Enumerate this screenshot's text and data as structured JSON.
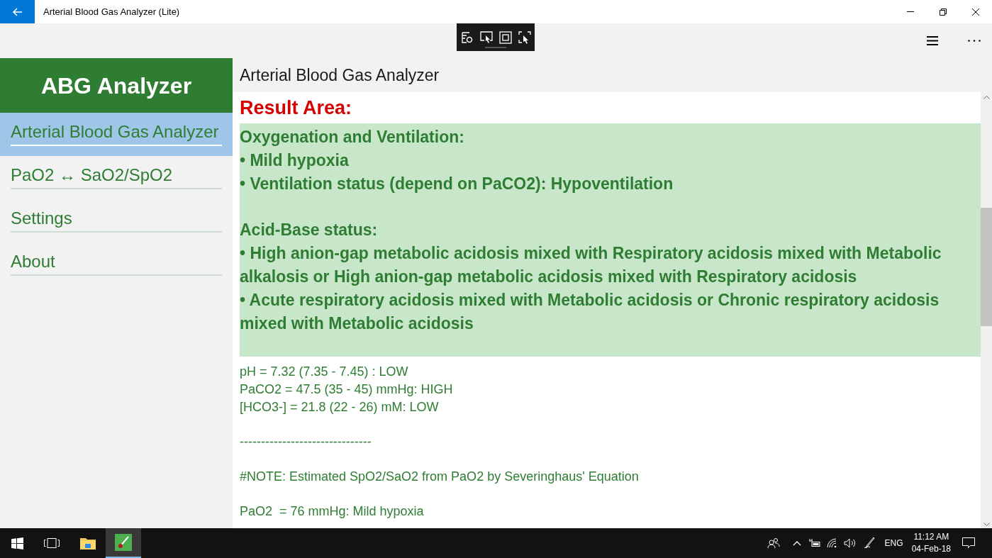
{
  "window": {
    "title": "Arterial Blood Gas Analyzer (Lite)"
  },
  "sidebar": {
    "app_title": "ABG Analyzer",
    "items": [
      {
        "label": "Arterial Blood Gas Analyzer",
        "selected": true
      },
      {
        "label": "PaO2 ↔ SaO2/SpO2",
        "selected": false
      },
      {
        "label": "Settings",
        "selected": false
      },
      {
        "label": "About",
        "selected": false
      }
    ]
  },
  "main": {
    "page_title": "Arterial Blood Gas Analyzer",
    "result_heading": "Result Area:",
    "result_box": [
      {
        "heading": "Oxygenation and Ventilation:",
        "bullets": [
          "• Mild hypoxia",
          "• Ventilation status (depend on PaCO2): Hypoventilation"
        ]
      },
      {
        "heading": "Acid-Base status:",
        "bullets": [
          "• High anion-gap metabolic acidosis mixed with Respiratory acidosis mixed with Metabolic alkalosis or High anion-gap metabolic acidosis mixed with Respiratory acidosis",
          "• Acute respiratory acidosis mixed with Metabolic acidosis or Chronic respiratory acidosis mixed with Metabolic acidosis"
        ]
      }
    ],
    "details": [
      [
        "pH = 7.32 (7.35 - 7.45) : LOW",
        "PaCO2 = 47.5 (35 - 45) mmHg: HIGH",
        "[HCO3-] = 21.8 (22 - 26) mM: LOW"
      ],
      [
        "-------------------------------"
      ],
      [
        "#NOTE: Estimated SpO2/SaO2 from PaO2 by Severinghaus' Equation"
      ],
      [
        "PaO2  = 76 mmHg: Mild hypoxia"
      ]
    ]
  },
  "taskbar": {
    "language": "ENG",
    "time": "11:12 AM",
    "date": "04-Feb-18"
  }
}
